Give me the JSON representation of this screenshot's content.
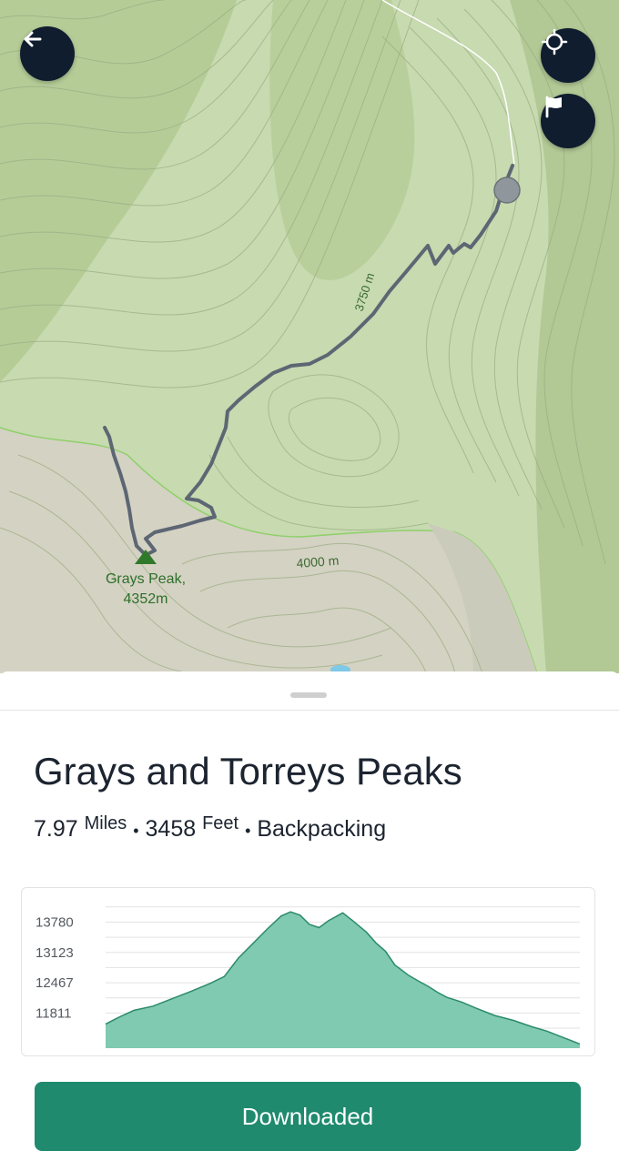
{
  "map": {
    "peak_name": "Grays Peak,",
    "peak_elevation": "4352m",
    "contour_label_1": "3750 m",
    "contour_label_2": "4000 m"
  },
  "controls": {
    "back_icon": "arrow-left-icon",
    "locate_icon": "crosshair-icon",
    "flag_icon": "flag-icon"
  },
  "trail": {
    "title": "Grays and Torreys Peaks",
    "distance_value": "7.97",
    "distance_unit": "Miles",
    "separator": "•",
    "elevation_value": "3458",
    "elevation_unit": "Feet",
    "activity": "Backpacking"
  },
  "chart_data": {
    "type": "area",
    "y_ticks": [
      "13780",
      "13123",
      "12467",
      "11811"
    ],
    "y_tick_values": [
      13780,
      13123,
      12467,
      11811
    ],
    "ylim": [
      11050,
      14320
    ],
    "x": [
      0,
      0.03,
      0.06,
      0.1,
      0.14,
      0.18,
      0.22,
      0.25,
      0.28,
      0.31,
      0.34,
      0.37,
      0.39,
      0.41,
      0.43,
      0.45,
      0.47,
      0.5,
      0.52,
      0.55,
      0.57,
      0.59,
      0.61,
      0.64,
      0.66,
      0.68,
      0.7,
      0.72,
      0.75,
      0.78,
      0.82,
      0.86,
      0.9,
      0.93,
      0.96,
      1.0
    ],
    "values": [
      11570,
      11730,
      11870,
      11960,
      12120,
      12280,
      12450,
      12600,
      13000,
      13310,
      13620,
      13910,
      14000,
      13930,
      13730,
      13660,
      13810,
      13980,
      13820,
      13560,
      13330,
      13150,
      12850,
      12620,
      12500,
      12390,
      12260,
      12150,
      12050,
      11920,
      11760,
      11650,
      11510,
      11420,
      11300,
      11140
    ],
    "color": "#7fcab0",
    "line_color": "#2c8a6c",
    "grid": true
  },
  "actions": {
    "download_label": "Downloaded"
  },
  "colors": {
    "accent": "#1f8a6e",
    "map_button": "#0f1d2e",
    "trail_line": "#5d6673"
  }
}
